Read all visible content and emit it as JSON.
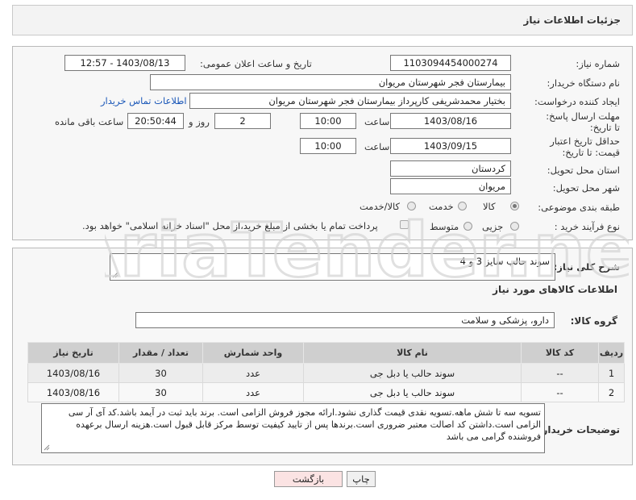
{
  "header": {
    "title": "جزئیات اطلاعات نیاز"
  },
  "form": {
    "need_number": {
      "label": "شماره نیاز:",
      "value": "1103094454000274"
    },
    "announce": {
      "label": "تاریخ و ساعت اعلان عمومی:",
      "value": "1403/08/13 - 12:57"
    },
    "buyer": {
      "label": "نام دستگاه خریدار:",
      "value": "بیمارستان فجر شهرستان مریوان"
    },
    "requester": {
      "label": "ایجاد کننده درخواست:",
      "value": "بختیار محمدشریفی کارپرداز بیمارستان فجر شهرستان مریوان",
      "contact_link": "اطلاعات تماس خریدار"
    },
    "deadline": {
      "label": "مهلت ارسال پاسخ: تا تاریخ:",
      "date": "1403/08/16",
      "time_label": "ساعت",
      "time": "10:00",
      "days": "2",
      "days_label": "روز و",
      "remaining": "20:50:44",
      "remaining_label": "ساعت باقی مانده"
    },
    "validity": {
      "label": "حداقل تاریخ اعتبار قیمت: تا تاریخ:",
      "date": "1403/09/15",
      "time_label": "ساعت",
      "time": "10:00"
    },
    "province": {
      "label": "استان محل تحویل:",
      "value": "کردستان"
    },
    "city": {
      "label": "شهر محل تحویل:",
      "value": "مریوان"
    },
    "category": {
      "label": "طبقه بندی موضوعی:",
      "options": [
        "کالا",
        "خدمت",
        "کالا/خدمت"
      ],
      "selected": "کالا"
    },
    "purchase_type": {
      "label": "نوع فرآیند خرید :",
      "options": [
        "جزیی",
        "متوسط"
      ],
      "payment_text": "پرداخت تمام یا بخشی از مبلغ خرید،از محل \"اسناد خزانه اسلامی\" خواهد بود."
    }
  },
  "description": {
    "label": "شرح کلی نیاز:",
    "value": "سوند حالب سایز 3 و 4"
  },
  "goods_info": {
    "title": "اطلاعات کالاهای مورد نیاز"
  },
  "goods_group": {
    "label": "گروه کالا:",
    "value": "دارو، پزشکی و سلامت"
  },
  "table": {
    "headers": [
      "ردیف",
      "کد کالا",
      "نام کالا",
      "واحد شمارش",
      "تعداد / مقدار",
      "تاریخ نیاز"
    ],
    "rows": [
      [
        "1",
        "--",
        "سوند حالب یا دبل جی",
        "عدد",
        "30",
        "1403/08/16"
      ],
      [
        "2",
        "--",
        "سوند حالب یا دبل جی",
        "عدد",
        "30",
        "1403/08/16"
      ]
    ]
  },
  "buyer_notes": {
    "label": "توضیحات خریدار:",
    "value": "تسویه سه تا شش ماهه.تسویه نقدی قیمت گذاری نشود.ارائه مجوز فروش الزامی است. برند باید ثبت در آیمد باشد.کد آی آر سی الزامی است.داشتن کد اصالت معتبر ضروری است.برندها پس از تایید کیفیت توسط مرکز قابل قبول است.هزینه ارسال برعهده فروشنده گرامی می باشد"
  },
  "buttons": {
    "print": "چاپ",
    "back": "بازگشت"
  },
  "watermark": {
    "text": "AriaTender.net"
  }
}
